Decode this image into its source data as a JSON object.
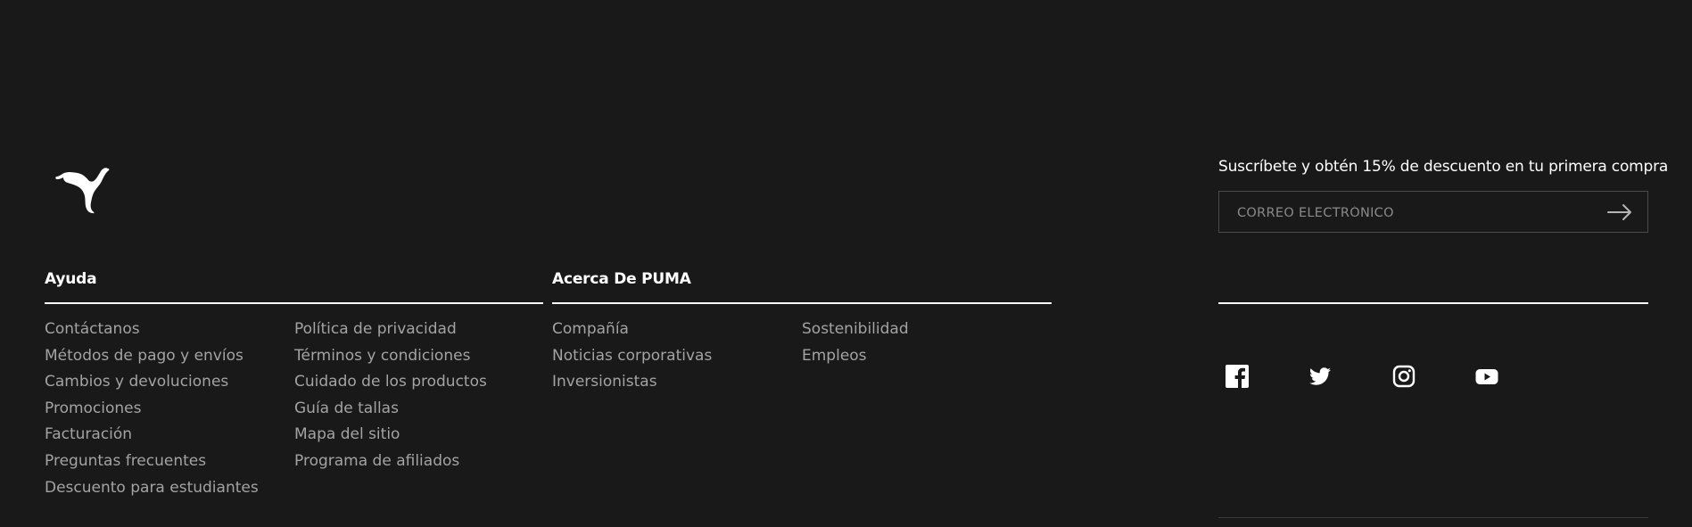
{
  "colors": {
    "background": "#191919",
    "heading": "#ffffff",
    "link": "#a3a3a3",
    "rule": "#ffffff"
  },
  "logo": {
    "icon": "puma-cat-logo-icon"
  },
  "help": {
    "title": "Ayuda",
    "col1": [
      "Contáctanos",
      "Métodos de pago y envíos",
      "Cambios y devoluciones",
      "Promociones",
      "Facturación",
      "Preguntas frecuentes",
      "Descuento para estudiantes"
    ],
    "col2": [
      "Política de privacidad",
      "Términos y condiciones",
      "Cuidado de los productos",
      "Guía de tallas",
      "Mapa del sitio",
      "Programa de afiliados"
    ]
  },
  "about": {
    "title": "Acerca De PUMA",
    "col1": [
      "Compañía",
      "Noticias corporativas",
      "Inversionistas"
    ],
    "col2": [
      "Sostenibilidad",
      "Empleos"
    ]
  },
  "newsletter": {
    "title": "Suscríbete y obtén 15% de descuento en tu primera compra",
    "email_placeholder": "CORREO ELECTRÓNICO",
    "email_value": "",
    "submit_icon": "arrow-right-icon"
  },
  "social": [
    {
      "icon": "facebook-icon"
    },
    {
      "icon": "twitter-icon"
    },
    {
      "icon": "instagram-icon"
    },
    {
      "icon": "youtube-icon"
    }
  ]
}
